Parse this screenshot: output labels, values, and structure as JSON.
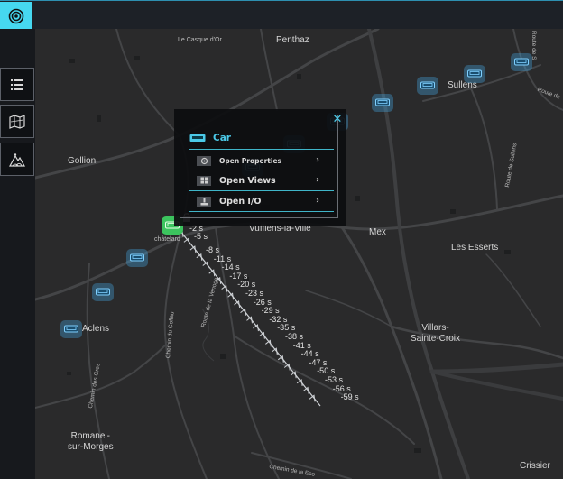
{
  "toolbar": {
    "logo_icon": "target-icon"
  },
  "sidebar": {
    "items": [
      {
        "name": "list-view",
        "icon": "list-icon"
      },
      {
        "name": "map-view",
        "icon": "map-icon"
      },
      {
        "name": "terrain-view",
        "icon": "terrain-icon"
      }
    ]
  },
  "map": {
    "places": [
      "Le Casque d'Or",
      "Penthaz",
      "Sullens",
      "Gollion",
      "Vufflens-la-Ville",
      "Mex",
      "Les Esserts",
      "Aclens",
      "Villars-\nSainte-Croix",
      "Romanel-\nsur-Morges",
      "Crissier",
      "Route de S",
      "Route de",
      "Route de Sullens",
      "Route de la Venoge",
      "Chemin du Coflau",
      "Chemin des Gres",
      "Chemin de la Eco",
      "chatelard chemin"
    ],
    "selected_vehicle_label": "châtelard",
    "time_labels": [
      "-2 s",
      "-5 s",
      "-8 s",
      "-11 s",
      "-14 s",
      "-17 s",
      "-20 s",
      "-23 s",
      "-26 s",
      "-29 s",
      "-32 s",
      "-35 s",
      "-38 s",
      "-41 s",
      "-44 s",
      "-47 s",
      "-50 s",
      "-53 s",
      "-56 s",
      "-59 s"
    ],
    "colors": {
      "background": "#2a2a2b",
      "road": "#454648",
      "trail": "#cfd2d6",
      "marker": "#46aae6",
      "selected": "#3cc45e"
    }
  },
  "popup": {
    "title": "Car",
    "close": "✕",
    "items": [
      {
        "label": "Open Properties",
        "icon": "gear-icon"
      },
      {
        "label": "Open Views",
        "icon": "grid-icon"
      },
      {
        "label": "Open I/O",
        "icon": "io-icon"
      }
    ],
    "chevron": "›",
    "lock_icon": "lock-icon"
  }
}
